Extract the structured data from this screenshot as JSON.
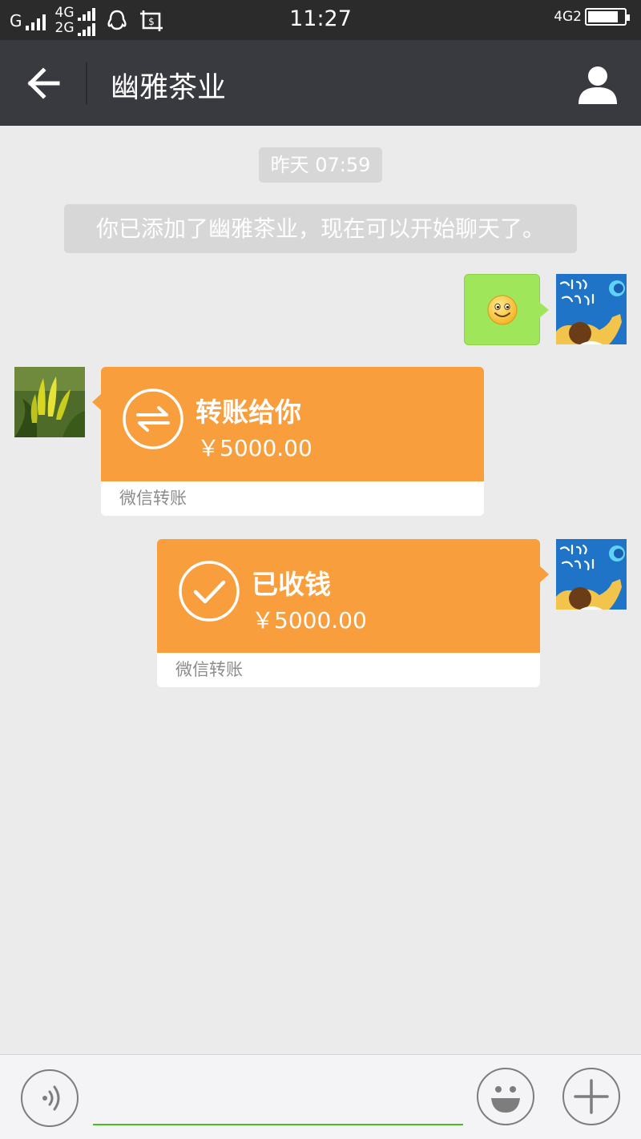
{
  "status_bar": {
    "network1": "G",
    "network2_top": "4G",
    "network2_bottom": "2G",
    "time": "11:27",
    "network_right": "4G2",
    "battery_level": 0.85,
    "icons": [
      "signal-icon",
      "qq-icon",
      "screenshot-icon",
      "battery-icon"
    ]
  },
  "header": {
    "title": "幽雅茶业",
    "back_icon": "arrow-left-icon",
    "profile_icon": "person-icon"
  },
  "chat": {
    "timestamp": "昨天 07:59",
    "system_message": "你已添加了幽雅茶业，现在可以开始聊天了。",
    "messages": [
      {
        "side": "right",
        "type": "emoji",
        "content": "smiley-emoji"
      },
      {
        "side": "left",
        "type": "transfer",
        "title": "转账给你",
        "amount": "￥5000.00",
        "footer": "微信转账",
        "icon": "transfer-arrows-icon"
      },
      {
        "side": "right",
        "type": "transfer",
        "title": "已收钱",
        "amount": "￥5000.00",
        "footer": "微信转账",
        "icon": "check-icon"
      }
    ]
  },
  "input_bar": {
    "voice_icon": "voice-icon",
    "emoji_icon": "emoji-face-icon",
    "plus_icon": "plus-icon",
    "text_value": ""
  },
  "colors": {
    "header_bg": "#393a3f",
    "chat_bg": "#ebebeb",
    "bubble_green": "#a0e65a",
    "transfer_orange": "#f99e3d",
    "input_underline": "#45c01a"
  }
}
